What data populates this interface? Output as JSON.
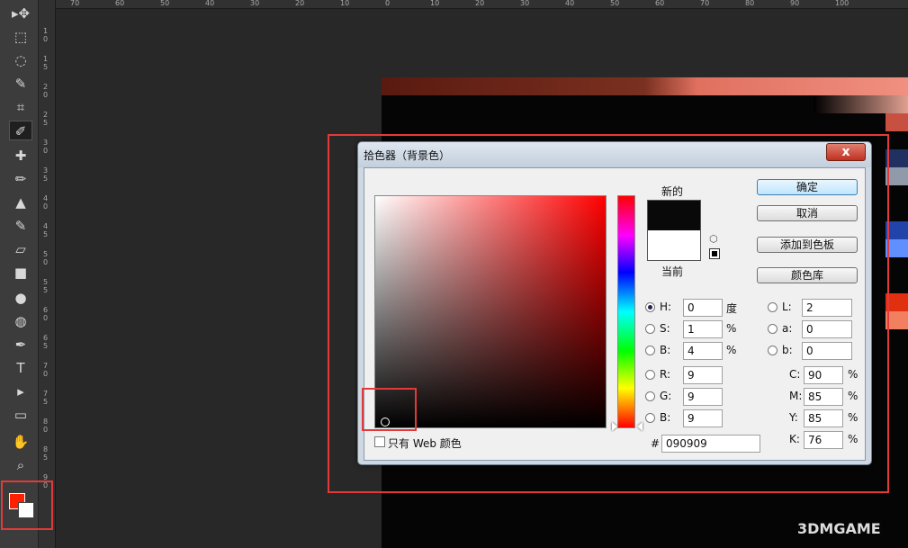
{
  "toolbar": {
    "tools": [
      "move-icon",
      "marquee-icon",
      "lasso-icon",
      "quick-select-icon",
      "crop-icon",
      "eyedropper-icon",
      "healing-icon",
      "brush-icon",
      "stamp-icon",
      "history-brush-icon",
      "eraser-icon",
      "gradient-icon",
      "blur-icon",
      "dodge-icon",
      "pen-icon",
      "type-icon",
      "path-select-icon",
      "rectangle-icon",
      "hand-icon",
      "zoom-icon"
    ],
    "glyphs": [
      "▸✥",
      "⬚",
      "◌",
      "✎",
      "⌗",
      "✐",
      "✚",
      "✏",
      "▲",
      "✎",
      "▱",
      "■",
      "●",
      "◍",
      "✒",
      "T",
      "▸",
      "▭",
      "✋",
      "⌕"
    ],
    "foreground_color": "#ff2000",
    "background_color": "#ffffff"
  },
  "hruler": [
    "70",
    "60",
    "50",
    "40",
    "30",
    "20",
    "10",
    "0",
    "10",
    "20",
    "30",
    "40",
    "50",
    "60",
    "70",
    "80",
    "90",
    "100"
  ],
  "vruler": [
    "1 0",
    "1 5",
    "2 0",
    "2 5",
    "3 0",
    "3 5",
    "4 0",
    "4 5",
    "5 0",
    "5 5",
    "6 0",
    "6 5",
    "7 0",
    "7 5",
    "8 0",
    "8 5",
    "9 0"
  ],
  "dialog": {
    "title": "拾色器（背景色）",
    "close": "x",
    "new_label": "新的",
    "current_label": "当前",
    "buttons": {
      "ok": "确定",
      "cancel": "取消",
      "add_swatch": "添加到色板",
      "color_library": "颜色库"
    },
    "hsb": {
      "h_label": "H:",
      "h_value": "0",
      "h_unit": "度",
      "s_label": "S:",
      "s_value": "1",
      "s_unit": "%",
      "b_label": "B:",
      "b_value": "4",
      "b_unit": "%"
    },
    "lab": {
      "l_label": "L:",
      "l_value": "2",
      "a_label": "a:",
      "a_value": "0",
      "b_label": "b:",
      "b_value": "0"
    },
    "rgb": {
      "r_label": "R:",
      "r_value": "9",
      "g_label": "G:",
      "g_value": "9",
      "b_label": "B:",
      "b_value": "9"
    },
    "cmyk": {
      "c_label": "C:",
      "c_value": "90",
      "c_unit": "%",
      "m_label": "M:",
      "m_value": "85",
      "m_unit": "%",
      "y_label": "Y:",
      "y_value": "85",
      "y_unit": "%",
      "k_label": "K:",
      "k_value": "76",
      "k_unit": "%"
    },
    "hex_label": "#",
    "hex_value": "090909",
    "web_only_label": "只有 Web 颜色",
    "new_color": "#090909",
    "current_color": "#ffffff"
  },
  "watermark": "3DMGAME",
  "colors": {
    "highlight": "#e23a3a"
  }
}
